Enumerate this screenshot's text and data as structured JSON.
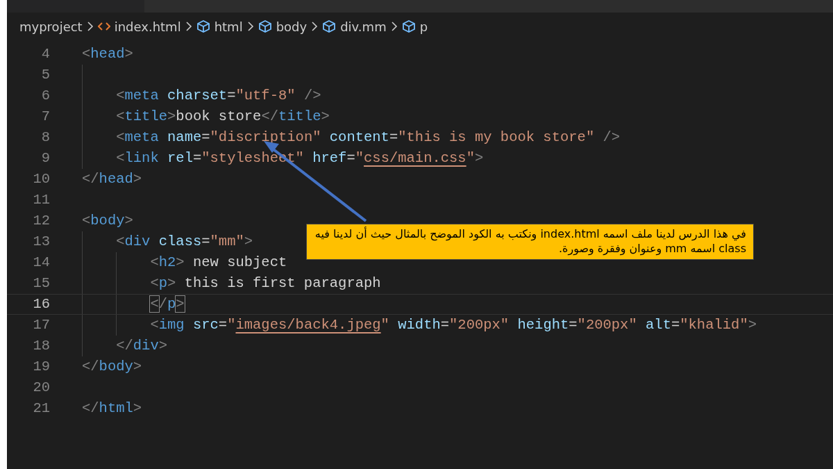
{
  "breadcrumb": [
    {
      "label": "myproject",
      "kind": "folder"
    },
    {
      "label": "index.html",
      "kind": "file"
    },
    {
      "label": "html",
      "kind": "element"
    },
    {
      "label": "body",
      "kind": "element"
    },
    {
      "label": "div.mm",
      "kind": "element"
    },
    {
      "label": "p",
      "kind": "element"
    }
  ],
  "lines": [
    {
      "number": "4",
      "current": false,
      "segments": [
        {
          "kind": "punct",
          "text": "<"
        },
        {
          "kind": "tag",
          "text": "head"
        },
        {
          "kind": "punct",
          "text": ">"
        }
      ]
    },
    {
      "number": "5",
      "current": false
    },
    {
      "number": "6",
      "current": false,
      "segments": [
        {
          "kind": "punct",
          "text": "    <"
        },
        {
          "kind": "tag",
          "text": "meta"
        },
        {
          "kind": "attr",
          "text": " charset"
        },
        {
          "kind": "text",
          "text": "="
        },
        {
          "kind": "string",
          "text": "\"utf-8\""
        },
        {
          "kind": "punct",
          "text": " />"
        }
      ]
    },
    {
      "number": "7",
      "current": false,
      "segments": [
        {
          "kind": "punct",
          "text": "    <"
        },
        {
          "kind": "tag",
          "text": "title"
        },
        {
          "kind": "punct",
          "text": ">"
        },
        {
          "kind": "text",
          "text": "book store"
        },
        {
          "kind": "punct",
          "text": "</"
        },
        {
          "kind": "tag",
          "text": "title"
        },
        {
          "kind": "punct",
          "text": ">"
        }
      ]
    },
    {
      "number": "8",
      "current": false,
      "segments": [
        {
          "kind": "punct",
          "text": "    <"
        },
        {
          "kind": "tag",
          "text": "meta"
        },
        {
          "kind": "attr",
          "text": " name"
        },
        {
          "kind": "text",
          "text": "="
        },
        {
          "kind": "string",
          "text": "\"discription\""
        },
        {
          "kind": "attr",
          "text": " content"
        },
        {
          "kind": "text",
          "text": "="
        },
        {
          "kind": "string",
          "text": "\"this is my book store\""
        },
        {
          "kind": "punct",
          "text": " />"
        }
      ]
    },
    {
      "number": "9",
      "current": false,
      "segments": [
        {
          "kind": "punct",
          "text": "    <"
        },
        {
          "kind": "tag",
          "text": "link"
        },
        {
          "kind": "attr",
          "text": " rel"
        },
        {
          "kind": "text",
          "text": "="
        },
        {
          "kind": "string",
          "text": "\"stylesheet\""
        },
        {
          "kind": "attr",
          "text": " href"
        },
        {
          "kind": "text",
          "text": "="
        },
        {
          "kind": "string",
          "text": "\""
        },
        {
          "kind": "link",
          "text": "css/main.css"
        },
        {
          "kind": "string",
          "text": "\""
        },
        {
          "kind": "punct",
          "text": ">"
        }
      ]
    },
    {
      "number": "10",
      "current": false,
      "segments": [
        {
          "kind": "punct",
          "text": "</"
        },
        {
          "kind": "tag",
          "text": "head"
        },
        {
          "kind": "punct",
          "text": ">"
        }
      ]
    },
    {
      "number": "11",
      "current": false
    },
    {
      "number": "12",
      "current": false,
      "segments": [
        {
          "kind": "punct",
          "text": "<"
        },
        {
          "kind": "tag",
          "text": "body"
        },
        {
          "kind": "punct",
          "text": ">"
        }
      ]
    },
    {
      "number": "13",
      "current": false,
      "segments": [
        {
          "kind": "punct",
          "text": "    <"
        },
        {
          "kind": "tag",
          "text": "div"
        },
        {
          "kind": "attr",
          "text": " class"
        },
        {
          "kind": "text",
          "text": "="
        },
        {
          "kind": "string",
          "text": "\"mm\""
        },
        {
          "kind": "punct",
          "text": ">"
        }
      ]
    },
    {
      "number": "14",
      "current": false,
      "segments": [
        {
          "kind": "punct",
          "text": "        <"
        },
        {
          "kind": "tag",
          "text": "h2"
        },
        {
          "kind": "punct",
          "text": ">"
        },
        {
          "kind": "text",
          "text": " new subject"
        }
      ]
    },
    {
      "number": "15",
      "current": false,
      "segments": [
        {
          "kind": "punct",
          "text": "        <"
        },
        {
          "kind": "tag",
          "text": "p"
        },
        {
          "kind": "punct",
          "text": ">"
        },
        {
          "kind": "text",
          "text": " this is first paragraph"
        }
      ]
    },
    {
      "number": "16",
      "current": true,
      "segments": [
        {
          "kind": "match",
          "text": "        <"
        },
        {
          "kind": "punct",
          "text": "/"
        },
        {
          "kind": "tag",
          "text": "p"
        },
        {
          "kind": "match",
          "text": ">"
        }
      ]
    },
    {
      "number": "17",
      "current": false,
      "segments": [
        {
          "kind": "punct",
          "text": "        <"
        },
        {
          "kind": "tag",
          "text": "img"
        },
        {
          "kind": "attr",
          "text": " src"
        },
        {
          "kind": "text",
          "text": "="
        },
        {
          "kind": "string",
          "text": "\""
        },
        {
          "kind": "link",
          "text": "images/back4.jpeg"
        },
        {
          "kind": "string",
          "text": "\""
        },
        {
          "kind": "attr",
          "text": " width"
        },
        {
          "kind": "text",
          "text": "="
        },
        {
          "kind": "string",
          "text": "\"200px\""
        },
        {
          "kind": "attr",
          "text": " height"
        },
        {
          "kind": "text",
          "text": "="
        },
        {
          "kind": "string",
          "text": "\"200px\""
        },
        {
          "kind": "attr",
          "text": " alt"
        },
        {
          "kind": "text",
          "text": "="
        },
        {
          "kind": "string",
          "text": "\"khalid\""
        },
        {
          "kind": "punct",
          "text": ">"
        }
      ]
    },
    {
      "number": "18",
      "current": false,
      "segments": [
        {
          "kind": "punct",
          "text": "    </"
        },
        {
          "kind": "tag",
          "text": "div"
        },
        {
          "kind": "punct",
          "text": ">"
        }
      ]
    },
    {
      "number": "19",
      "current": false,
      "segments": [
        {
          "kind": "punct",
          "text": "</"
        },
        {
          "kind": "tag",
          "text": "body"
        },
        {
          "kind": "punct",
          "text": ">"
        }
      ]
    },
    {
      "number": "20",
      "current": false
    },
    {
      "number": "21",
      "current": false,
      "segments": [
        {
          "kind": "punct",
          "text": "</"
        },
        {
          "kind": "tag",
          "text": "html"
        },
        {
          "kind": "punct",
          "text": ">"
        }
      ]
    }
  ],
  "callout": {
    "text": "في هذا الدرس لدينا ملف اسمه index.html ونكتب به الكود الموضح بالمثال حيث أن لدينا فيه class اسمه mm وعنوان وفقرة وصورة."
  }
}
